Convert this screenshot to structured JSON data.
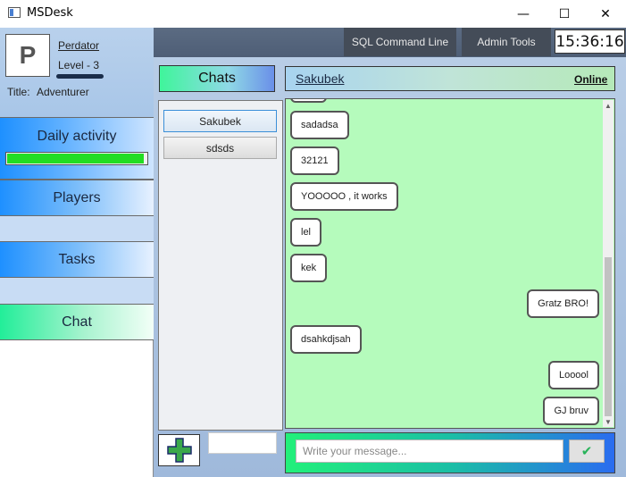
{
  "window": {
    "title": "MSDesk",
    "minimize_glyph": "—",
    "maximize_glyph": "☐",
    "close_glyph": "✕"
  },
  "profile": {
    "avatar_letter": "P",
    "username": "Perdator",
    "level": "Level - 3",
    "title_label": "Title:",
    "title_value": "Adventurer"
  },
  "nav": {
    "daily_activity": "Daily activity",
    "daily_progress": 0.98,
    "players": "Players",
    "tasks": "Tasks",
    "chat": "Chat"
  },
  "toolbar": {
    "sql_command_line": "SQL Command Line",
    "admin_tools": "Admin Tools",
    "clock": "15:36:16"
  },
  "chats": {
    "header": "Chats",
    "contacts": [
      "Sakubek",
      "sdsds"
    ],
    "active_contact": "Sakubek",
    "status": "Online"
  },
  "messages": [
    {
      "text": "sadadsa",
      "side": "left"
    },
    {
      "text": "32121",
      "side": "left"
    },
    {
      "text": "YOOOOO , it works",
      "side": "left"
    },
    {
      "text": "lel",
      "side": "left"
    },
    {
      "text": "kek",
      "side": "left"
    },
    {
      "text": "Gratz BRO!",
      "side": "right"
    },
    {
      "text": "dsahkdjsah",
      "side": "left"
    },
    {
      "text": "Looool",
      "side": "right"
    },
    {
      "text": "GJ bruv",
      "side": "right"
    }
  ],
  "compose": {
    "placeholder": "Write your message...",
    "send_icon": "check-icon"
  },
  "colors": {
    "chat_background": "#b5fbbc",
    "progress_fill": "#22dd22",
    "toolbar_button": "#444c58"
  }
}
